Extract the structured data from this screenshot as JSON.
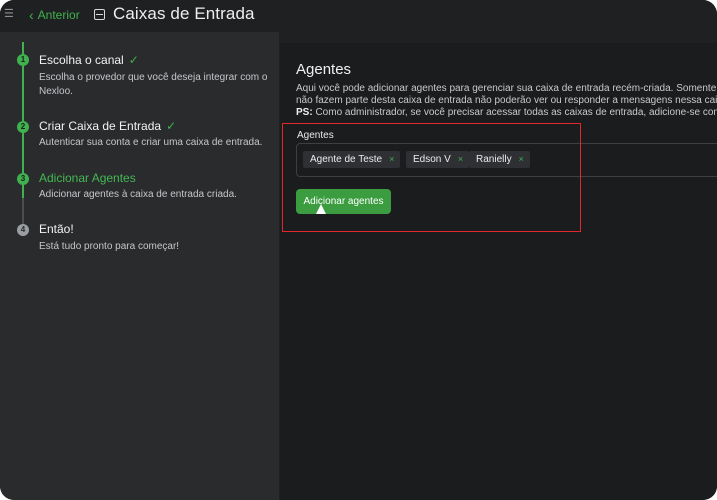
{
  "header": {
    "back_label": "Anterior",
    "title": "Caixas de Entrada"
  },
  "steps": [
    {
      "number": "1",
      "title": "Escolha o canal",
      "description": "Escolha o provedor que você deseja integrar com o Nexloo.",
      "done": true
    },
    {
      "number": "2",
      "title": "Criar Caixa de Entrada",
      "description": "Autenticar sua conta e criar uma caixa de entrada.",
      "done": true
    },
    {
      "number": "3",
      "title": "Adicionar Agentes",
      "description": "Adicionar agentes à caixa de entrada criada.",
      "active": true
    },
    {
      "number": "4",
      "title": "Então!",
      "description": "Está tudo pronto para começar!"
    }
  ],
  "main": {
    "title": "Agentes",
    "description_line1": "Aqui você pode adicionar agentes para gerenciar sua caixa de entrada recém-criada. Somente e",
    "description_line2": "não fazem parte desta caixa de entrada não poderão ver ou responder a mensagens nessa caixa",
    "ps_label": "PS:",
    "ps_text": " Como administrador, se você precisar acessar todas as caixas de entrada, adicione-se como",
    "field_label": "Agentes",
    "tags": [
      "Agente de Teste",
      "Edson V",
      "Ranielly"
    ],
    "remove_glyph": "×",
    "submit_label": "Adicionar agentes"
  },
  "colors": {
    "accent": "#3fb24f",
    "highlight": "#e2262a"
  }
}
